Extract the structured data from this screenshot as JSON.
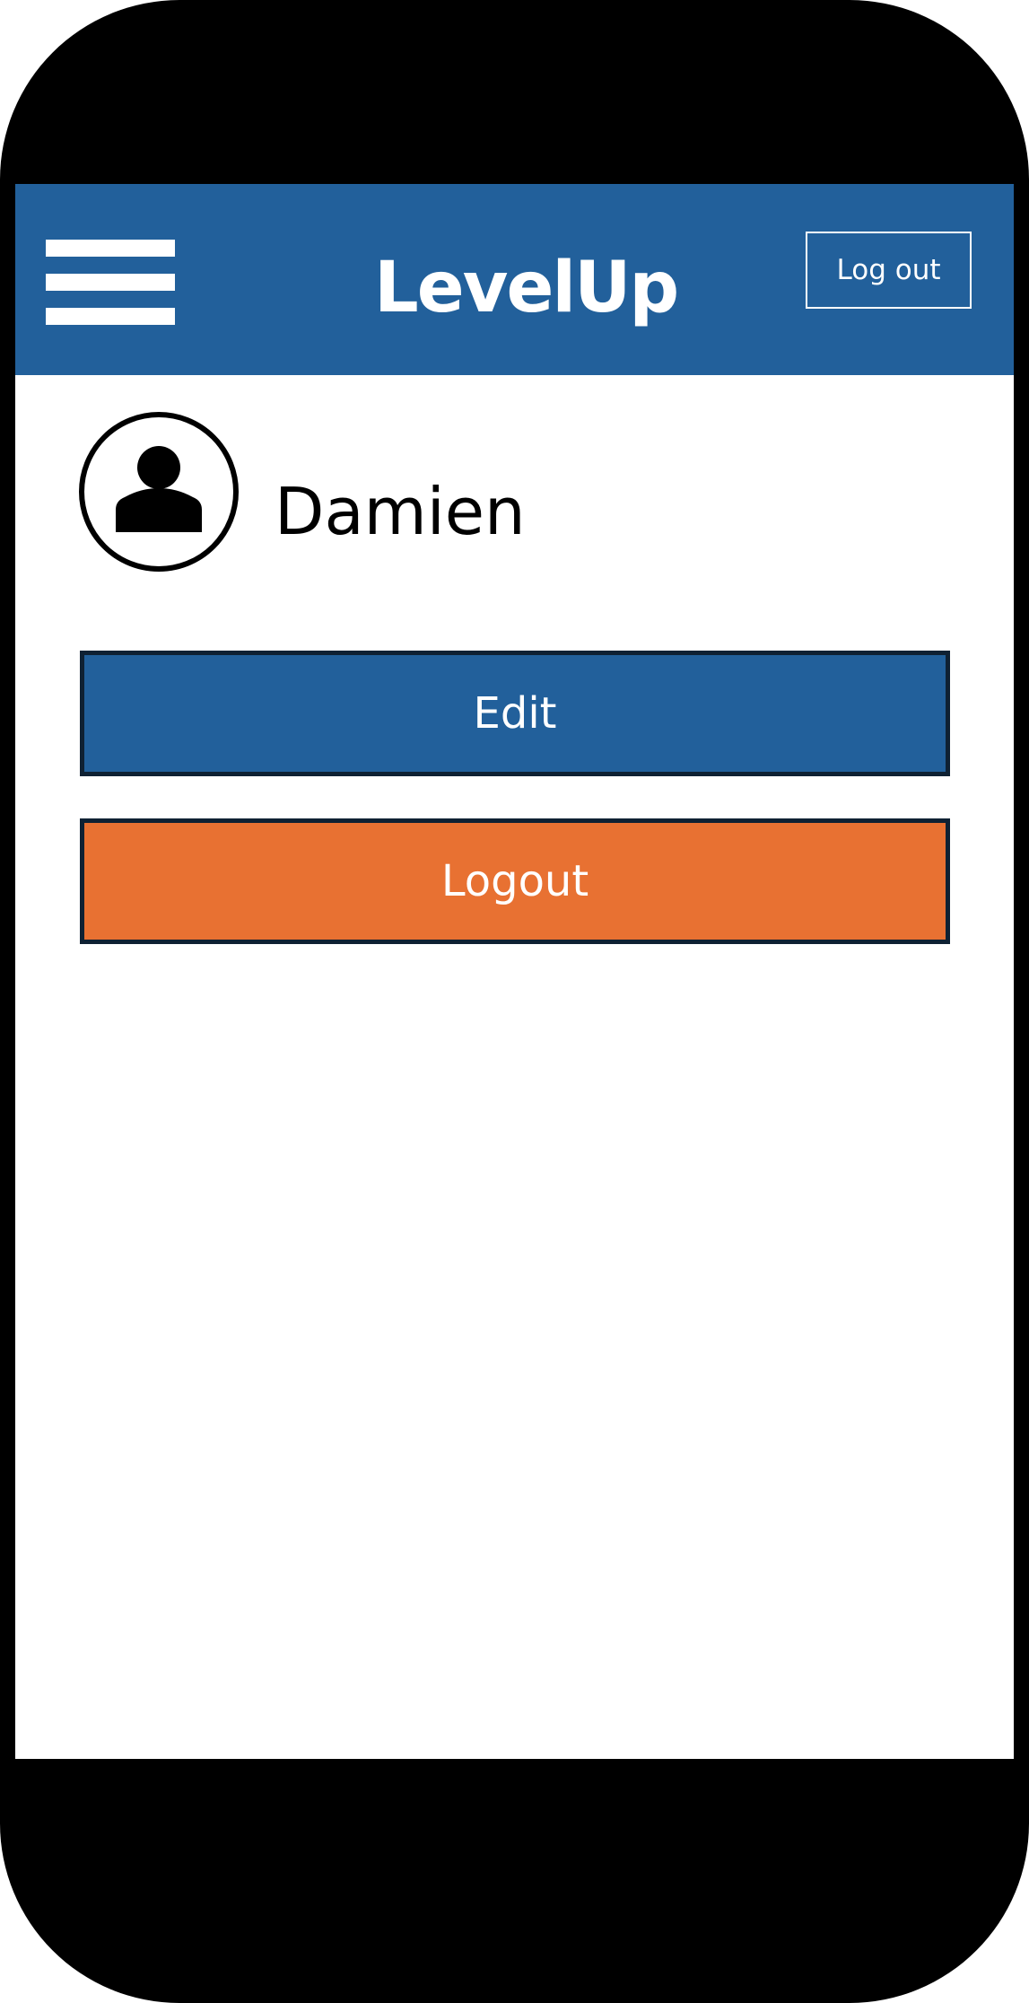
{
  "app": {
    "logo_text": "LevelUp",
    "colors": {
      "header_bg": "#22609b",
      "edit_button_bg": "#22609b",
      "logout_button_bg": "#e87132",
      "button_border": "#0f2133",
      "header_text": "#ffffff"
    }
  },
  "header": {
    "menu_icon": "hamburger-menu-icon",
    "logout_label": "Log out"
  },
  "profile": {
    "avatar_icon": "user-avatar-icon",
    "name": "Damien"
  },
  "actions": {
    "edit_label": "Edit",
    "logout_label": "Logout"
  }
}
